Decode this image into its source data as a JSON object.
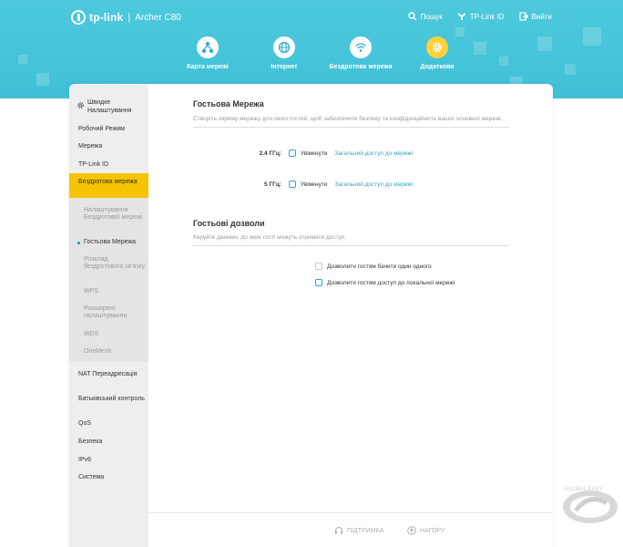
{
  "header": {
    "brand": "tp-link",
    "separator": "|",
    "model": "Archer C80",
    "links": [
      {
        "label": "Пошук",
        "icon": "search-icon"
      },
      {
        "label": "TP-Link ID",
        "icon": "tplink-id-icon"
      },
      {
        "label": "Вийти",
        "icon": "logout-icon"
      }
    ],
    "nav": [
      {
        "label": "Карта мережі",
        "icon": "network-map-icon"
      },
      {
        "label": "Інтернет",
        "icon": "globe-icon"
      },
      {
        "label": "Бездротова мережа",
        "icon": "wifi-icon"
      },
      {
        "label": "Додатково",
        "icon": "gear-icon",
        "active": true
      }
    ],
    "colors": {
      "header": "#45c4d9",
      "active_nav": "#ffd23c"
    }
  },
  "sidebar": {
    "items": [
      {
        "label": "Швидке Налаштування",
        "icon": "gear-icon"
      },
      {
        "label": "Робочий Режим"
      },
      {
        "label": "Мережа"
      },
      {
        "label": "TP-Link ID"
      },
      {
        "label": "Бездротова мережа",
        "active": true
      },
      {
        "label": "NAT Переадресація"
      },
      {
        "label": "Батьківський контроль"
      },
      {
        "label": "QoS"
      },
      {
        "label": "Безпека"
      },
      {
        "label": "IPv6"
      },
      {
        "label": "Система"
      }
    ],
    "subitems": [
      {
        "label": "Налаштування Бездротової мережі"
      },
      {
        "label": "Гостьова Мережа",
        "current": true
      },
      {
        "label": "Розклад бездротового зв'язку"
      },
      {
        "label": "WPS"
      },
      {
        "label": "Розширені налаштування"
      },
      {
        "label": "WDS"
      },
      {
        "label": "OneMesh"
      }
    ],
    "colors": {
      "active": "#f5c400"
    }
  },
  "guest_network": {
    "title": "Гостьова Мережа",
    "description": "Створіть окрему мережу для своїх гостей, щоб забезпечити безпеку та конфіденційність вашої основної мережі.",
    "bands": [
      {
        "label": "2.4 ГГц:",
        "enable_label": "Увімкнути",
        "link": "Загальний доступ до мережі"
      },
      {
        "label": "5 ГГц:",
        "enable_label": "Увімкнути",
        "link": "Загальний доступ до мережі"
      }
    ]
  },
  "guest_permissions": {
    "title": "Гостьові дозволи",
    "description": "Керуйте даними, до яких гості можуть отримати доступ.",
    "options": [
      {
        "label": "Дозволити гостям бачити один одного",
        "disabled": true
      },
      {
        "label": "Дозволити гостям доступ до локальної мережі",
        "disabled": false
      }
    ]
  },
  "footer": {
    "support_label": "ПІДТРИМКА",
    "top_label": "НАГОРУ"
  },
  "watermark": {
    "text": "GLOBAL EASY"
  }
}
